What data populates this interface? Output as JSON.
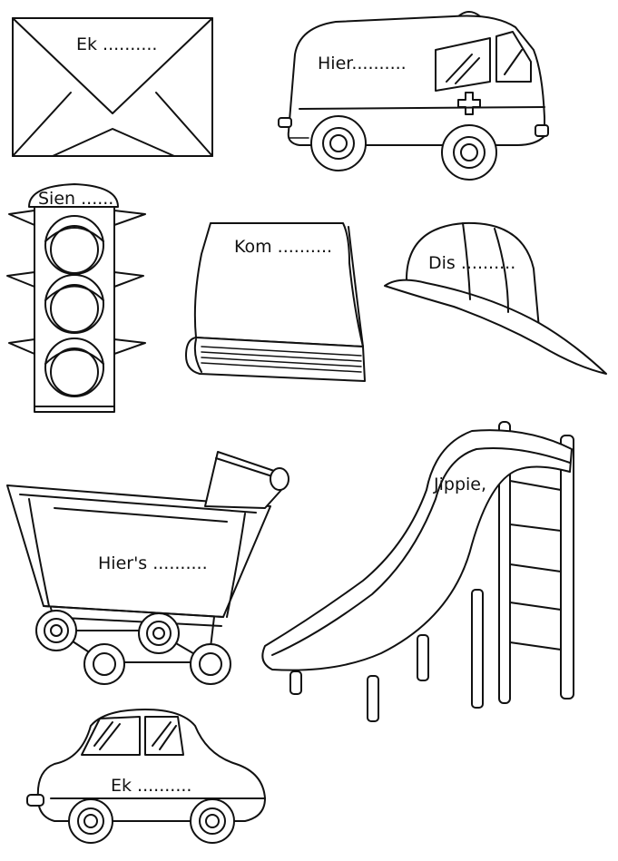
{
  "worksheet": {
    "labels": {
      "envelope": "Ek ..........",
      "ambulance": "Hier..........",
      "traffic_light": "Sien ......",
      "book": "Kom ..........",
      "cap": "Dis ..........",
      "trolley": "Hier's ..........",
      "slide": "Jippie,",
      "car": "Ek .........."
    },
    "icons": [
      "envelope-icon",
      "ambulance-icon",
      "traffic-light-icon",
      "book-icon",
      "cap-icon",
      "shopping-trolley-icon",
      "slide-icon",
      "car-icon"
    ],
    "colors": {
      "ink": "#111111",
      "paper": "#ffffff"
    }
  }
}
